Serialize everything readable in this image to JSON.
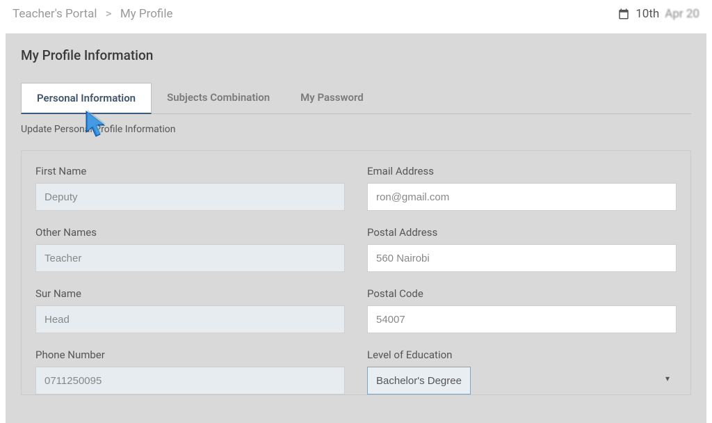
{
  "breadcrumb": {
    "root": "Teacher's Portal",
    "current": "My Profile"
  },
  "date": {
    "day": "10th",
    "rest": "Apr 20"
  },
  "panel": {
    "title": "My Profile Information"
  },
  "tabs": [
    {
      "label": "Personal Information",
      "active": true
    },
    {
      "label": "Subjects Combination",
      "active": false
    },
    {
      "label": "My Password",
      "active": false
    }
  ],
  "subhead": "Update Personal Profile Information",
  "form": {
    "first_name": {
      "label": "First Name",
      "value": "Deputy"
    },
    "email": {
      "label": "Email Address",
      "value": "ron@gmail.com"
    },
    "other_names": {
      "label": "Other Names",
      "value": "Teacher"
    },
    "postal_address": {
      "label": "Postal Address",
      "value": "560 Nairobi"
    },
    "sur_name": {
      "label": "Sur Name",
      "value": "Head"
    },
    "postal_code": {
      "label": "Postal Code",
      "value": "54007"
    },
    "phone": {
      "label": "Phone Number",
      "value": "0711250095"
    },
    "education": {
      "label": "Level of Education",
      "value": "Bachelor's Degree"
    }
  }
}
